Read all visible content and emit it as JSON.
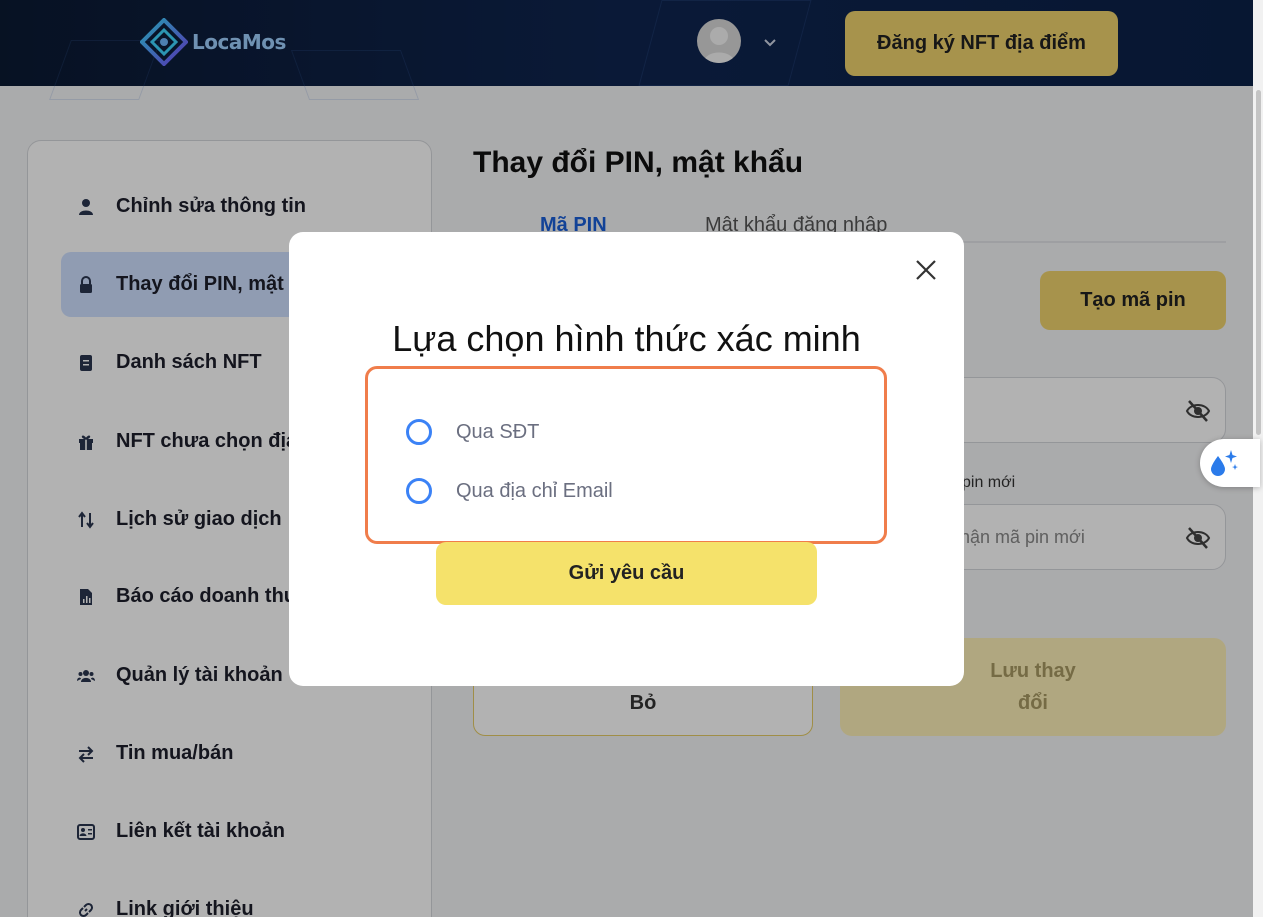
{
  "header": {
    "brand": "LocaMos",
    "register_nft_label": "Đăng ký NFT địa điểm"
  },
  "sidebar": {
    "items": [
      {
        "label": "Chỉnh sửa thông tin",
        "icon": "user-icon"
      },
      {
        "label": "Thay đổi PIN, mật",
        "icon": "lock-icon"
      },
      {
        "label": "Danh sách NFT",
        "icon": "document-icon"
      },
      {
        "label": "NFT chưa chọn địa",
        "icon": "gift-icon"
      },
      {
        "label": "Lịch sử giao dịch",
        "icon": "sort-arrows-icon"
      },
      {
        "label": "Báo cáo doanh thu",
        "icon": "report-icon"
      },
      {
        "label": "Quản lý tài khoản",
        "icon": "users-icon"
      },
      {
        "label": "Tin mua/bán",
        "icon": "swap-icon"
      },
      {
        "label": "Liên kết tài khoản",
        "icon": "link-account-icon"
      },
      {
        "label": "Link giới thiệu",
        "icon": "link-icon"
      }
    ]
  },
  "main": {
    "title": "Thay đổi PIN, mật khẩu",
    "tabs": [
      {
        "label": "Mã PIN",
        "active": true
      },
      {
        "label": "Mật khẩu đăng nhập",
        "active": false
      }
    ],
    "create_pin_label": "Tạo mã pin",
    "new_pin_label_partial": "pin mới",
    "confirm_pin_placeholder_partial": "hận mã pin mới",
    "cancel_label": "Bỏ",
    "save_label_line1": "Lưu thay",
    "save_label_line2": "đổi"
  },
  "modal": {
    "title": "Lựa chọn hình thức xác minh",
    "options": [
      {
        "label": "Qua SĐT",
        "selected": false
      },
      {
        "label": "Qua địa chỉ Email",
        "selected": false
      }
    ],
    "submit_label": "Gửi yêu cầu"
  },
  "colors": {
    "accent_yellow": "#f0d36e",
    "highlight_border": "#f07d4b",
    "radio_blue": "#3b82f6",
    "tab_active": "#1b5fd8"
  }
}
